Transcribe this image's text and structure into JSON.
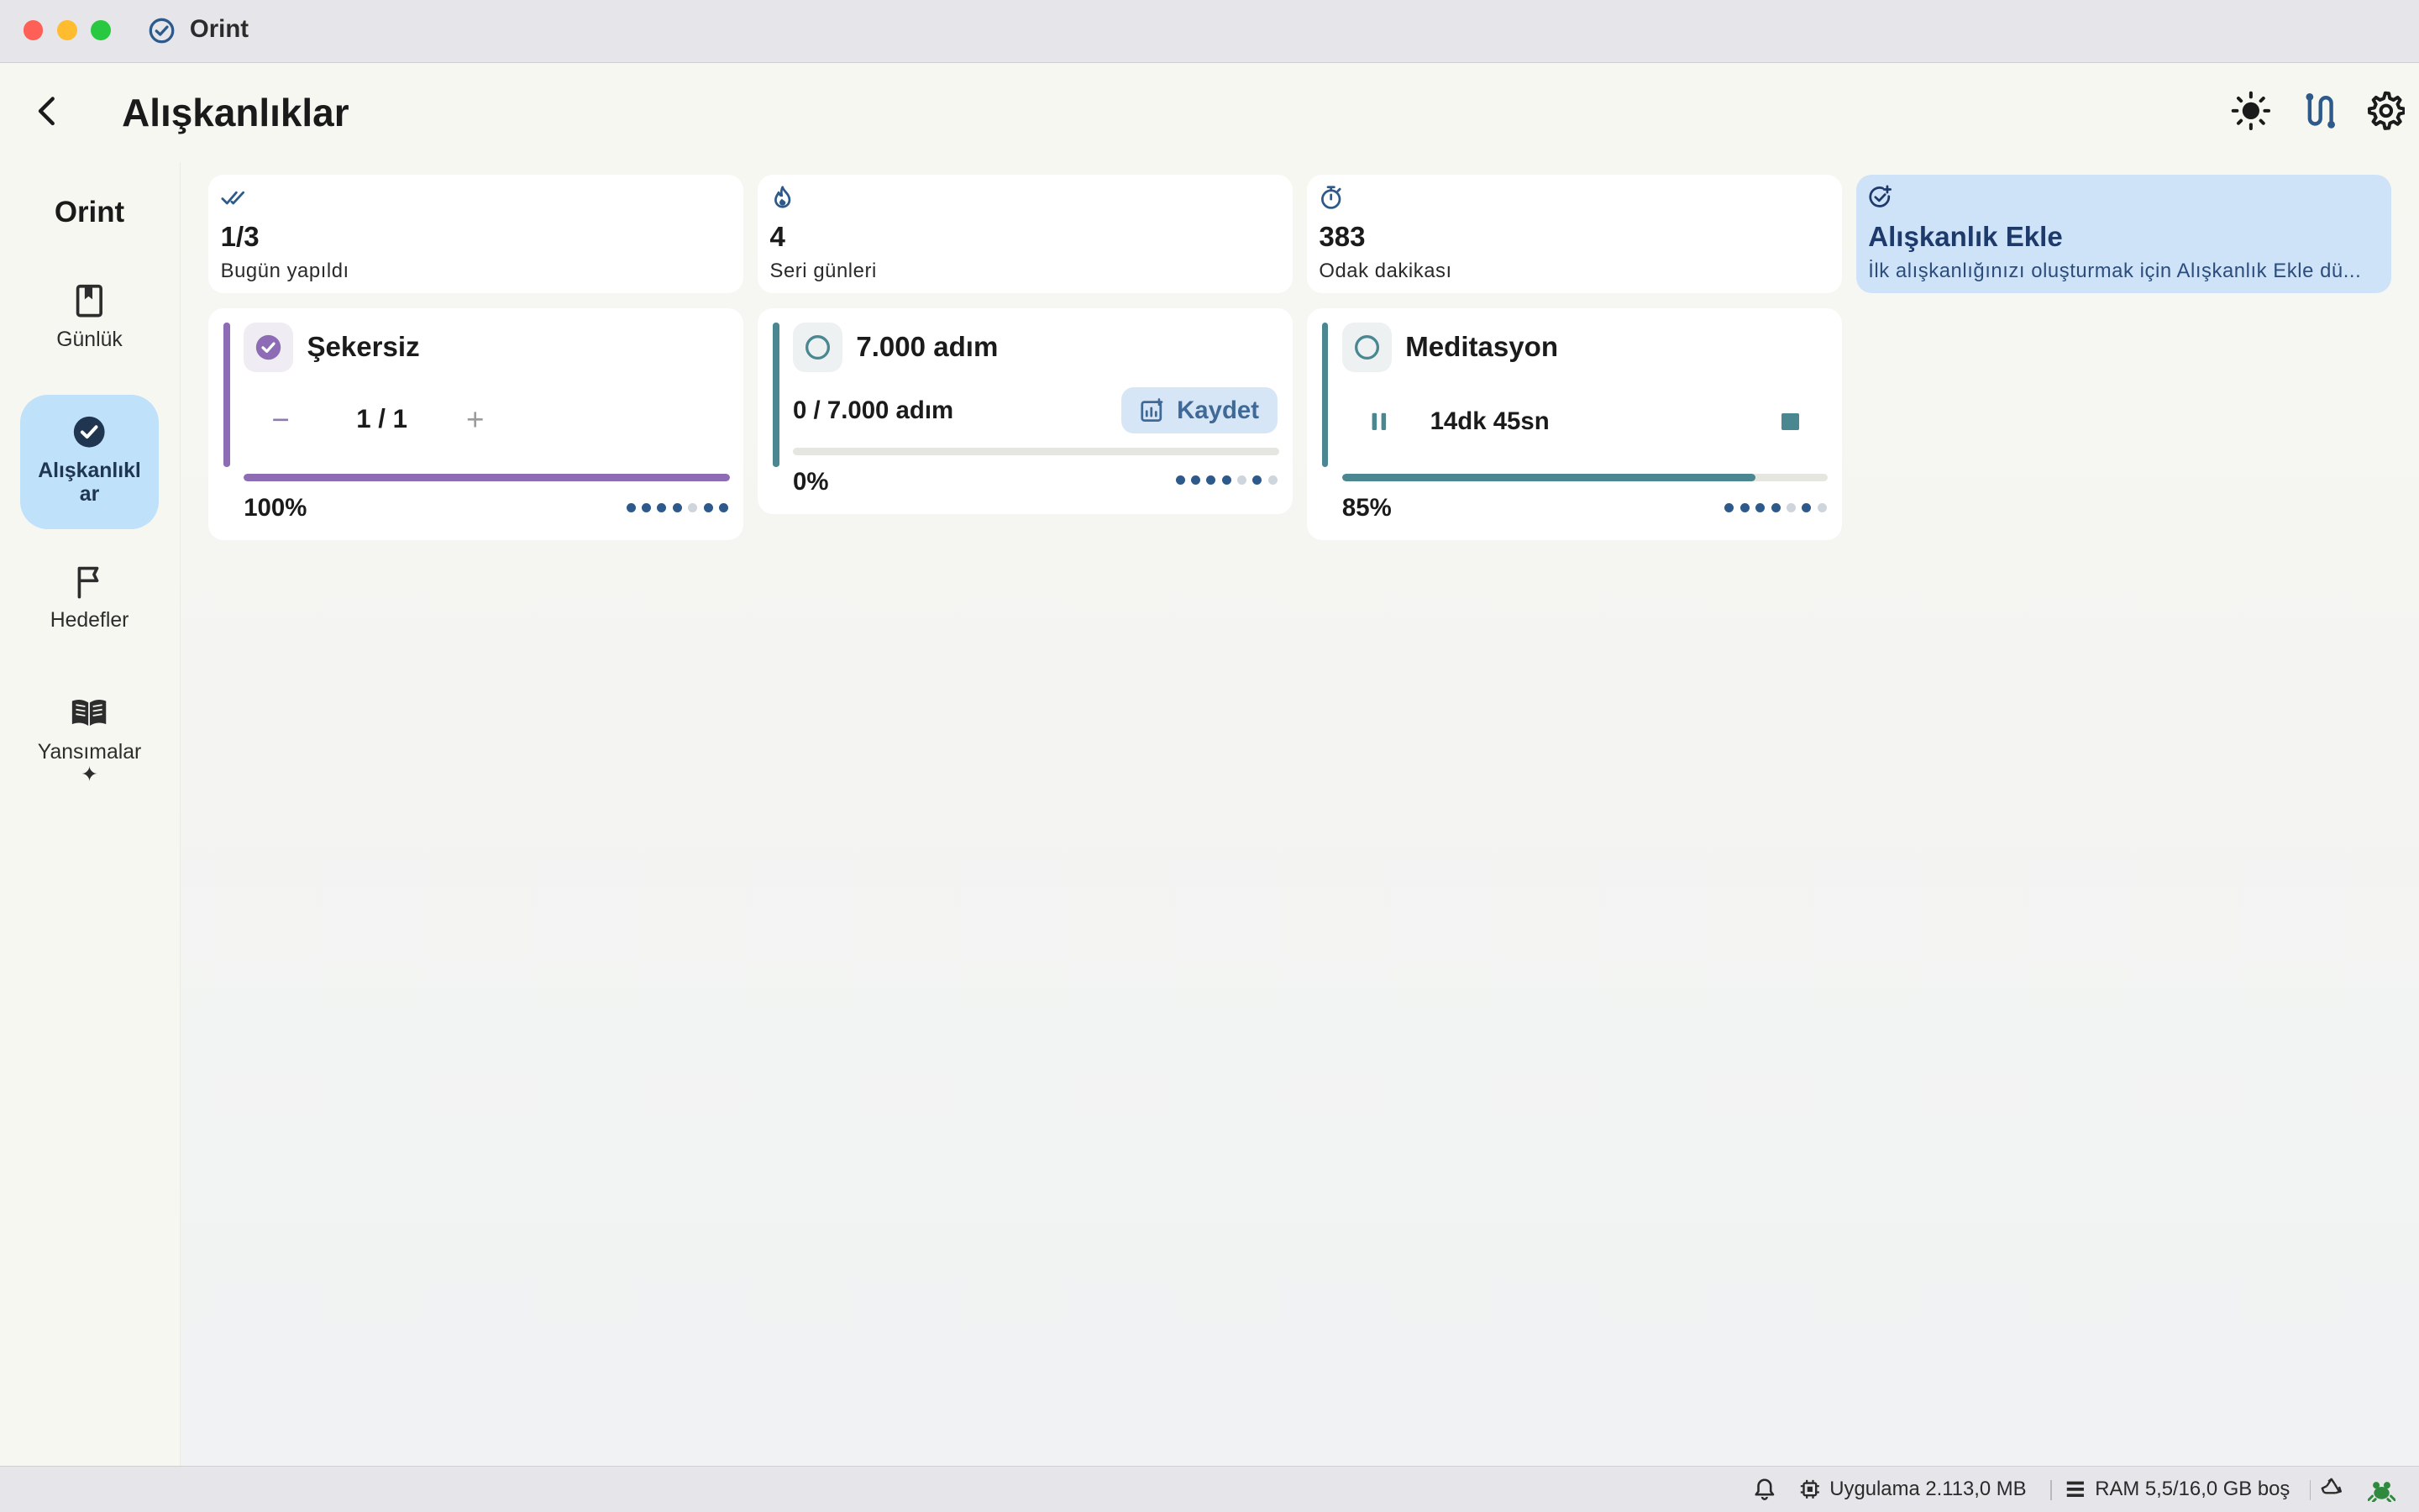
{
  "window": {
    "title": "Orint"
  },
  "header": {
    "title": "Alışkanlıklar"
  },
  "sidebar": {
    "brand": "Orint",
    "items": [
      {
        "label": "Günlük",
        "icon": "bookmark-icon"
      },
      {
        "label": "Alışkanlıklar",
        "icon": "check-circle-icon",
        "active": true
      },
      {
        "label": "Hedefler",
        "icon": "flag-icon"
      },
      {
        "label": "Yansımalar ✦",
        "icon": "open-book-icon"
      }
    ]
  },
  "stats": [
    {
      "value": "1/3",
      "label": "Bugün yapıldı",
      "icon": "double-check-icon"
    },
    {
      "value": "4",
      "label": "Seri günleri",
      "icon": "flame-icon"
    },
    {
      "value": "383",
      "label": "Odak dakikası",
      "icon": "stopwatch-icon"
    },
    {
      "value": "Alışkanlık Ekle",
      "label": "İlk alışkanlığınızı oluşturmak için Alışkanlık Ekle dü...",
      "icon": "add-check-icon"
    }
  ],
  "habits": [
    {
      "name": "Şekersiz",
      "counter": "1 / 1",
      "percent": "100%",
      "progress": 1.0,
      "done": true,
      "week": [
        1,
        1,
        1,
        0,
        1,
        1
      ]
    },
    {
      "name": "7.000 adım",
      "value": "0 / 7.000 adım",
      "action": "Kaydet",
      "percent": "0%",
      "progress": 0.0,
      "done": false,
      "week": [
        1,
        1,
        1,
        1,
        0,
        1,
        0
      ]
    },
    {
      "name": "Meditasyon",
      "timer": "14dk 45sn",
      "percent": "85%",
      "progress": 0.85,
      "done": false,
      "week": [
        1,
        1,
        1,
        1,
        0,
        1,
        0
      ]
    }
  ],
  "statusbar": {
    "app_memory": "Uygulama 2.113,0 MB",
    "ram": "RAM 5,5/16,0 GB boş"
  },
  "colors": {
    "accent": "#2d5a8a",
    "purple": "#8e6bb5",
    "teal": "#4a8790",
    "active_nav": "#bfe1f9"
  }
}
